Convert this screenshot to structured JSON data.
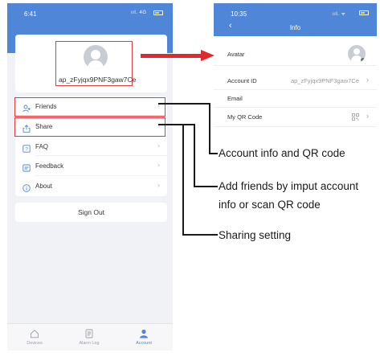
{
  "left_screen": {
    "status_bar": {
      "time": "6:41",
      "signal": "ııl. 4G"
    },
    "profile": {
      "account_id": "ap_zFyjqx9PNF3gaw7Ce"
    },
    "menu": [
      {
        "label": "Friends",
        "icon": "person-add-icon"
      },
      {
        "label": "Share",
        "icon": "share-icon"
      },
      {
        "label": "FAQ",
        "icon": "question-icon"
      },
      {
        "label": "Feedback",
        "icon": "feedback-icon"
      },
      {
        "label": "About",
        "icon": "info-icon"
      }
    ],
    "sign_out_label": "Sign Out",
    "tabs": [
      {
        "label": "Devices",
        "active": false
      },
      {
        "label": "Alarm Log",
        "active": false
      },
      {
        "label": "Account",
        "active": true
      }
    ]
  },
  "right_screen": {
    "status_bar": {
      "time": "10:35",
      "signal": "ııl. ᯤ"
    },
    "title": "Info",
    "rows": {
      "avatar_label": "Avatar",
      "account_id_label": "Account ID",
      "account_id_value": "ap_zFyjqx9PNF3gaw7Ce",
      "email_label": "Email",
      "qr_label": "My QR Code"
    }
  },
  "annotations": {
    "account_info": "Account info and QR code",
    "add_friends_line1": "Add friends by imput account",
    "add_friends_line2": "info or scan QR code",
    "sharing": "Sharing setting"
  },
  "colors": {
    "header_blue": "#4f86d8",
    "highlight_red": "#e03a3e",
    "page_bg": "#f1f2f6"
  }
}
